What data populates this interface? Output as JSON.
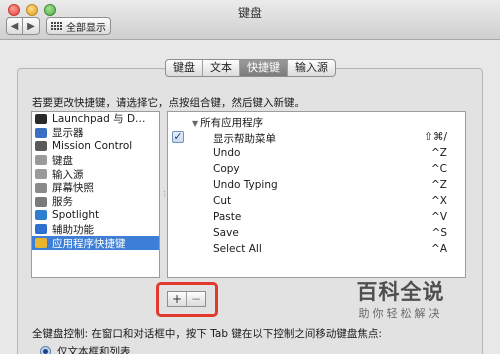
{
  "window": {
    "title": "键盘",
    "show_all_label": "全部显示",
    "back_glyph": "◀",
    "forward_glyph": "▶"
  },
  "tabs": [
    {
      "label": "键盘",
      "selected": false
    },
    {
      "label": "文本",
      "selected": false
    },
    {
      "label": "快捷键",
      "selected": true
    },
    {
      "label": "输入源",
      "selected": false
    }
  ],
  "instruction": "若要更改快捷键，请选择它，点按组合键，然后键入新键。",
  "categories": [
    {
      "label": "Launchpad 与 D…",
      "icon": "launchpad-icon",
      "color": "#2a2a2a",
      "selected": false
    },
    {
      "label": "显示器",
      "icon": "display-icon",
      "color": "#3a6fc4",
      "selected": false
    },
    {
      "label": "Mission Control",
      "icon": "mission-control-icon",
      "color": "#5a5a5a",
      "selected": false
    },
    {
      "label": "键盘",
      "icon": "keyboard-icon",
      "color": "#9a9a9a",
      "selected": false
    },
    {
      "label": "输入源",
      "icon": "input-source-icon",
      "color": "#9a9a9a",
      "selected": false
    },
    {
      "label": "屏幕快照",
      "icon": "screenshot-icon",
      "color": "#8a8a8a",
      "selected": false
    },
    {
      "label": "服务",
      "icon": "services-icon",
      "color": "#7a7a7a",
      "selected": false
    },
    {
      "label": "Spotlight",
      "icon": "spotlight-icon",
      "color": "#2f7fd0",
      "selected": false
    },
    {
      "label": "辅助功能",
      "icon": "accessibility-icon",
      "color": "#2f6fd0",
      "selected": false
    },
    {
      "label": "应用程序快捷键",
      "icon": "app-shortcuts-icon",
      "color": "#e9b52f",
      "selected": true
    }
  ],
  "shortcuts": {
    "group_label": "所有应用程序",
    "items": [
      {
        "name": "显示帮助菜单",
        "keys": "⇧⌘/",
        "checked": true
      },
      {
        "name": "Undo",
        "keys": "^Z",
        "checked": false
      },
      {
        "name": "Copy",
        "keys": "^C",
        "checked": false
      },
      {
        "name": "Undo Typing",
        "keys": "^Z",
        "checked": false
      },
      {
        "name": "Cut",
        "keys": "^X",
        "checked": false
      },
      {
        "name": "Paste",
        "keys": "^V",
        "checked": false
      },
      {
        "name": "Save",
        "keys": "^S",
        "checked": false
      },
      {
        "name": "Select All",
        "keys": "^A",
        "checked": false
      }
    ]
  },
  "buttons": {
    "add": "+",
    "remove": "−"
  },
  "keyboard_control": "全键盘控制: 在窗口和对话框中，按下 Tab 键在以下控制之间移动键盘焦点:",
  "radio_option": "仅文本框和列表",
  "watermark": {
    "main": "百科全说",
    "sub": "助你轻松解决"
  },
  "colors": {
    "selection": "#3d7fd6",
    "highlight": "#e03a2f"
  }
}
